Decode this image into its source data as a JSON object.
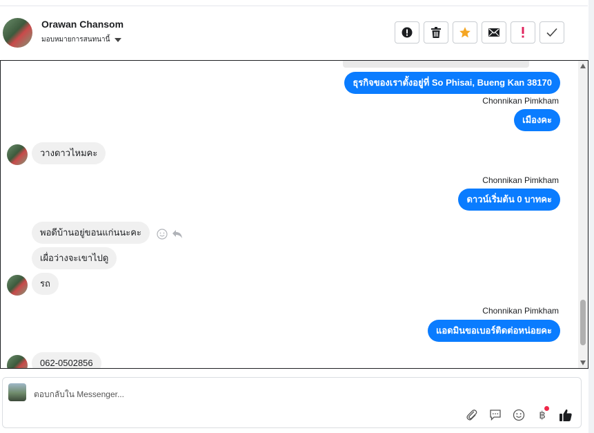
{
  "header": {
    "contact_name": "Orawan Chansom",
    "assign_label": "มอบหมายการสนทนานี้",
    "actions": [
      {
        "icon": "alert-circle-icon"
      },
      {
        "icon": "trash-icon"
      },
      {
        "icon": "star-icon"
      },
      {
        "icon": "mail-icon"
      },
      {
        "icon": "exclamation-icon"
      },
      {
        "icon": "check-icon"
      }
    ]
  },
  "messages": {
    "m1": "ธุรกิจของเราตั้งอยู่ที่ So Phisai, Bueng Kan 38170",
    "sender1": "Chonnikan Pimkham",
    "m2": "เมืองคะ",
    "m3": "วางดาวไหมคะ",
    "sender2": "Chonnikan Pimkham",
    "m4": "ดาวน์เริ่มต้น 0 บาทคะ",
    "m5": "พอดีบ้านอยู่ขอนแก่นนะคะ",
    "m6": "เผื่อว่างจะเขาไปดู",
    "m7": "รถ",
    "sender3": "Chonnikan Pimkham",
    "m8": "แอดมินขอเบอร์ติดต่อหน่อยคะ",
    "m9": "062-0502856"
  },
  "composer": {
    "placeholder": "ตอบกลับใน Messenger...",
    "tools": [
      "paperclip-icon",
      "chat-bubble-icon",
      "emoji-icon",
      "baht-icon",
      "thumbs-up-icon"
    ],
    "baht_symbol": "฿"
  },
  "colors": {
    "outgoing_bubble": "#0a7cff",
    "incoming_bubble": "#f0f0f0",
    "star": "#f5a623",
    "exclamation": "#e0245e",
    "notification_dot": "#f02849"
  }
}
